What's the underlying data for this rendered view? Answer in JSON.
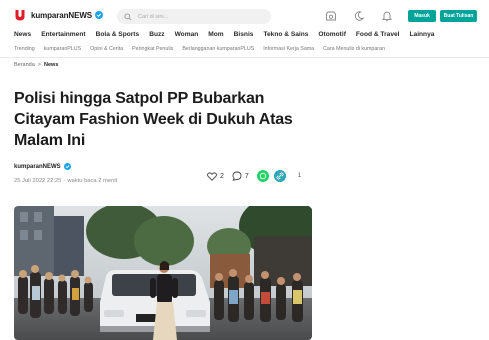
{
  "brand": {
    "name": "kumparanNEWS",
    "accent": "#00a49a",
    "logo_color": "#e11c2a"
  },
  "search": {
    "placeholder": "Cari di sini..."
  },
  "header": {
    "icons": [
      "tv-icon",
      "moon-icon",
      "bell-icon"
    ],
    "login_label": "Masuk",
    "write_label": "Buat Tulisan"
  },
  "nav": {
    "items": [
      "News",
      "Entertainment",
      "Bola & Sports",
      "Buzz",
      "Woman",
      "Mom",
      "Bisnis",
      "Tekno & Sains",
      "Otomotif",
      "Food & Travel",
      "Lainnya"
    ]
  },
  "subnav": {
    "items": [
      "Trending",
      "kumparanPLUS",
      "Opini & Cerita",
      "Peringkat Penulis",
      "Berlangganan kumparanPLUS",
      "Informasi Kerja Sama",
      "Cara Menulis di kumparan"
    ]
  },
  "breadcrumb": {
    "home": "Beranda",
    "separator": ">",
    "current": "News"
  },
  "article": {
    "title": "Polisi hingga Satpol PP Bubarkan Citayam Fashion Week di Dukuh Atas Malam Ini",
    "author": "kumparanNEWS",
    "date": "25 Juli 2022 22:25",
    "dot": "·",
    "read_time": "waktu baca 2 menit",
    "likes": "2",
    "comments": "7",
    "share_count": "1"
  }
}
